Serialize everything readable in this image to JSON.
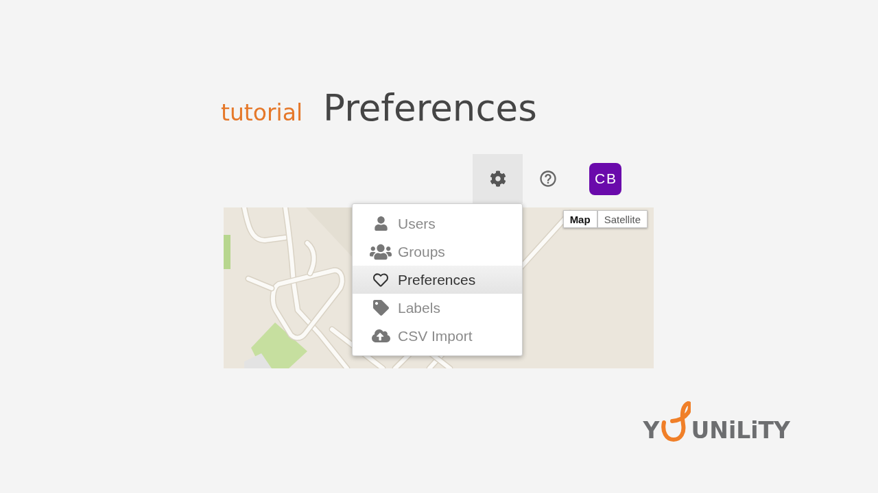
{
  "title": {
    "tag": "tutorial",
    "heading": "Preferences"
  },
  "toolbar": {
    "settings_open": true,
    "avatar": "CB"
  },
  "menu": {
    "items": [
      {
        "label": "Users",
        "selected": false
      },
      {
        "label": "Groups",
        "selected": false
      },
      {
        "label": "Preferences",
        "selected": true
      },
      {
        "label": "Labels",
        "selected": false
      },
      {
        "label": "CSV Import",
        "selected": false
      }
    ]
  },
  "map": {
    "map_types": [
      {
        "label": "Map",
        "selected": true
      },
      {
        "label": "Satellite",
        "selected": false
      }
    ]
  },
  "logo": {
    "lead": "Y",
    "rest": "UNiLiTY"
  }
}
